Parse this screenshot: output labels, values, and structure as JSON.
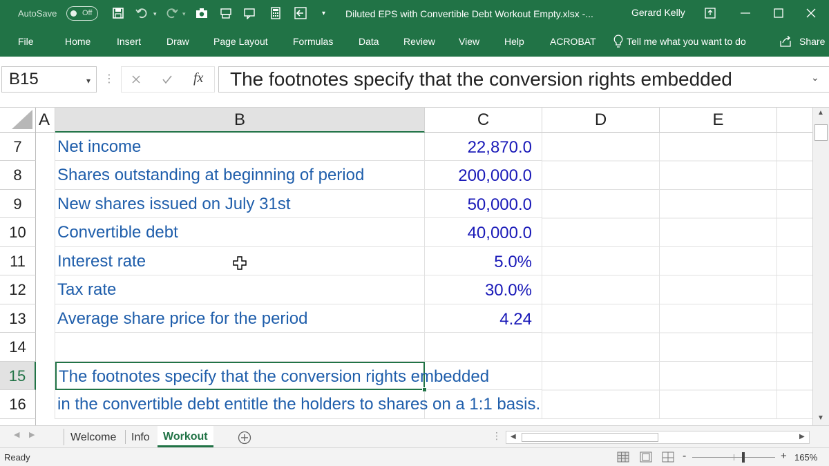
{
  "titlebar": {
    "autosave_label": "AutoSave",
    "autosave_state": "Off",
    "filename": "Diluted EPS with Convertible Debt Workout Empty.xlsx  -...",
    "user": "Gerard Kelly"
  },
  "ribbon": {
    "tabs": [
      "File",
      "Home",
      "Insert",
      "Draw",
      "Page Layout",
      "Formulas",
      "Data",
      "Review",
      "View",
      "Help",
      "ACROBAT"
    ],
    "tell_me": "Tell me what you want to do",
    "share": "Share"
  },
  "formula_bar": {
    "name_box": "B15",
    "fx": "fx",
    "content": "The footnotes specify that the conversion rights embedded"
  },
  "columns": [
    "A",
    "B",
    "C",
    "D",
    "E"
  ],
  "rows": [
    {
      "num": "7",
      "label": "Net income",
      "value": "22,870.0"
    },
    {
      "num": "8",
      "label": "Shares outstanding at beginning of period",
      "value": "200,000.0"
    },
    {
      "num": "9",
      "label": "New shares issued on July 31st",
      "value": "50,000.0"
    },
    {
      "num": "10",
      "label": "Convertible debt",
      "value": "40,000.0"
    },
    {
      "num": "11",
      "label": "Interest rate",
      "value": "5.0%"
    },
    {
      "num": "12",
      "label": "Tax rate",
      "value": "30.0%"
    },
    {
      "num": "13",
      "label": "Average share price for the period",
      "value": "4.24"
    },
    {
      "num": "14",
      "label": "",
      "value": ""
    },
    {
      "num": "15",
      "label": "The footnotes specify that the conversion rights embedded",
      "value": ""
    },
    {
      "num": "16",
      "label": "in the convertible debt entitle the holders to shares on a 1:1 basis.",
      "value": ""
    }
  ],
  "sheet_tabs": [
    "Welcome",
    "Info",
    "Workout"
  ],
  "active_sheet": "Workout",
  "status": {
    "ready": "Ready",
    "zoom": "165%"
  },
  "colors": {
    "excel_green": "#217346",
    "label_blue": "#1f5eab",
    "value_blue": "#1a1ab8"
  }
}
